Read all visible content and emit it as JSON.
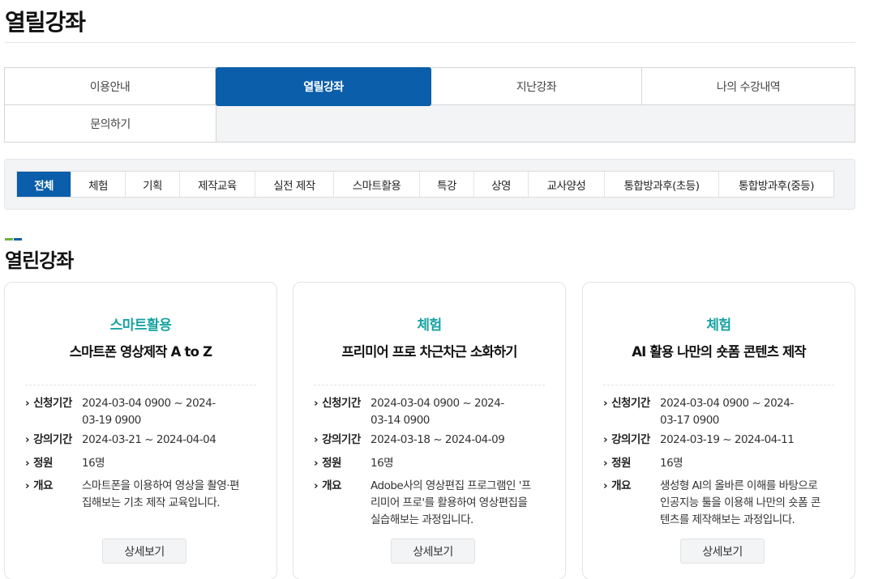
{
  "page_title": "열릴강좌",
  "tabs": [
    {
      "label": "이용안내"
    },
    {
      "label": "열릴강좌"
    },
    {
      "label": "지난강좌"
    },
    {
      "label": "나의 수강내역"
    },
    {
      "label": "문의하기"
    }
  ],
  "active_tab": "열릴강좌",
  "filters": [
    {
      "label": "전체"
    },
    {
      "label": "체험"
    },
    {
      "label": "기획"
    },
    {
      "label": "제작교육"
    },
    {
      "label": "실전 제작"
    },
    {
      "label": "스마트활용"
    },
    {
      "label": "특강"
    },
    {
      "label": "상영"
    },
    {
      "label": "교사양성"
    },
    {
      "label": "통합방과후(초등)"
    },
    {
      "label": "통합방과후(중등)"
    }
  ],
  "active_filter": "전체",
  "section": {
    "title": "열린강좌",
    "accent_colors": [
      "#6cb33f",
      "#0a5eaa"
    ]
  },
  "labels": {
    "apply_period": "신청기간",
    "course_period": "강의기간",
    "capacity": "정원",
    "summary": "개요",
    "detail_button": "상세보기"
  },
  "courses": [
    {
      "category": "스마트활용",
      "title": "스마트폰 영상제작 A to Z",
      "apply_period": "2024-03-04 0900 ~ 2024-03-19 0900",
      "course_period": "2024-03-21 ~ 2024-04-04",
      "capacity": "16명",
      "summary": "스마트폰을 이용하여 영상을 촬영·편집해보는 기초 제작 교육입니다."
    },
    {
      "category": "체험",
      "title": "프리미어 프로 차근차근 소화하기",
      "apply_period": "2024-03-04 0900 ~ 2024-03-14 0900",
      "course_period": "2024-03-18 ~ 2024-04-09",
      "capacity": "16명",
      "summary": "Adobe사의 영상편집 프로그램인 '프리미어 프로'를 활용하여 영상편집을 실습해보는 과정입니다."
    },
    {
      "category": "체험",
      "title": "AI 활용 나만의 숏폼 콘텐츠 제작",
      "apply_period": "2024-03-04 0900 ~ 2024-03-17 0900",
      "course_period": "2024-03-19 ~ 2024-04-11",
      "capacity": "16명",
      "summary": "생성형 AI의 올바른 이해를 바탕으로 인공지능 툴을 이용해 나만의 숏폼 콘텐츠를 제작해보는 과정입니다."
    }
  ]
}
